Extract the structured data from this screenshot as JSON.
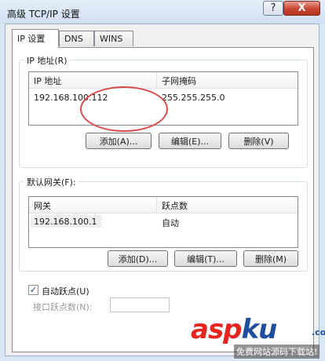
{
  "window": {
    "title": "高级 TCP/IP 设置",
    "help_label": "?",
    "close_label": "X"
  },
  "tabs": [
    {
      "label": "IP 设置",
      "active": true
    },
    {
      "label": "DNS",
      "active": false
    },
    {
      "label": "WINS",
      "active": false
    }
  ],
  "ip_group": {
    "label": "IP 地址(R)",
    "columns": [
      "IP 地址",
      "子网掩码"
    ],
    "rows": [
      {
        "ip": "192.168.100.112",
        "mask": "255.255.255.0"
      }
    ],
    "buttons": {
      "add": "添加(A)...",
      "edit": "编辑(E)...",
      "delete": "删除(V)"
    }
  },
  "gateway_group": {
    "label": "默认网关(F):",
    "columns": [
      "网关",
      "跃点数"
    ],
    "rows": [
      {
        "gateway": "192.168.100.1",
        "metric": "自动"
      }
    ],
    "buttons": {
      "add": "添加(D)...",
      "edit": "编辑(T)...",
      "delete": "删除(M)"
    }
  },
  "auto_metric": {
    "label": "自动跃点(U)",
    "checked": true,
    "check_glyph": "✓",
    "interface_metric_label": "接口跃点数(N):",
    "interface_metric_value": ""
  },
  "watermark": {
    "logo_main": "asp",
    "logo_accent": "ku",
    "logo_ext": ".com",
    "subtitle": "免费网站源码下载站!"
  },
  "colors": {
    "highlight_circle": "#d94a4a",
    "logo_red": "#e5261f",
    "logo_blue": "#1f4f9c"
  }
}
